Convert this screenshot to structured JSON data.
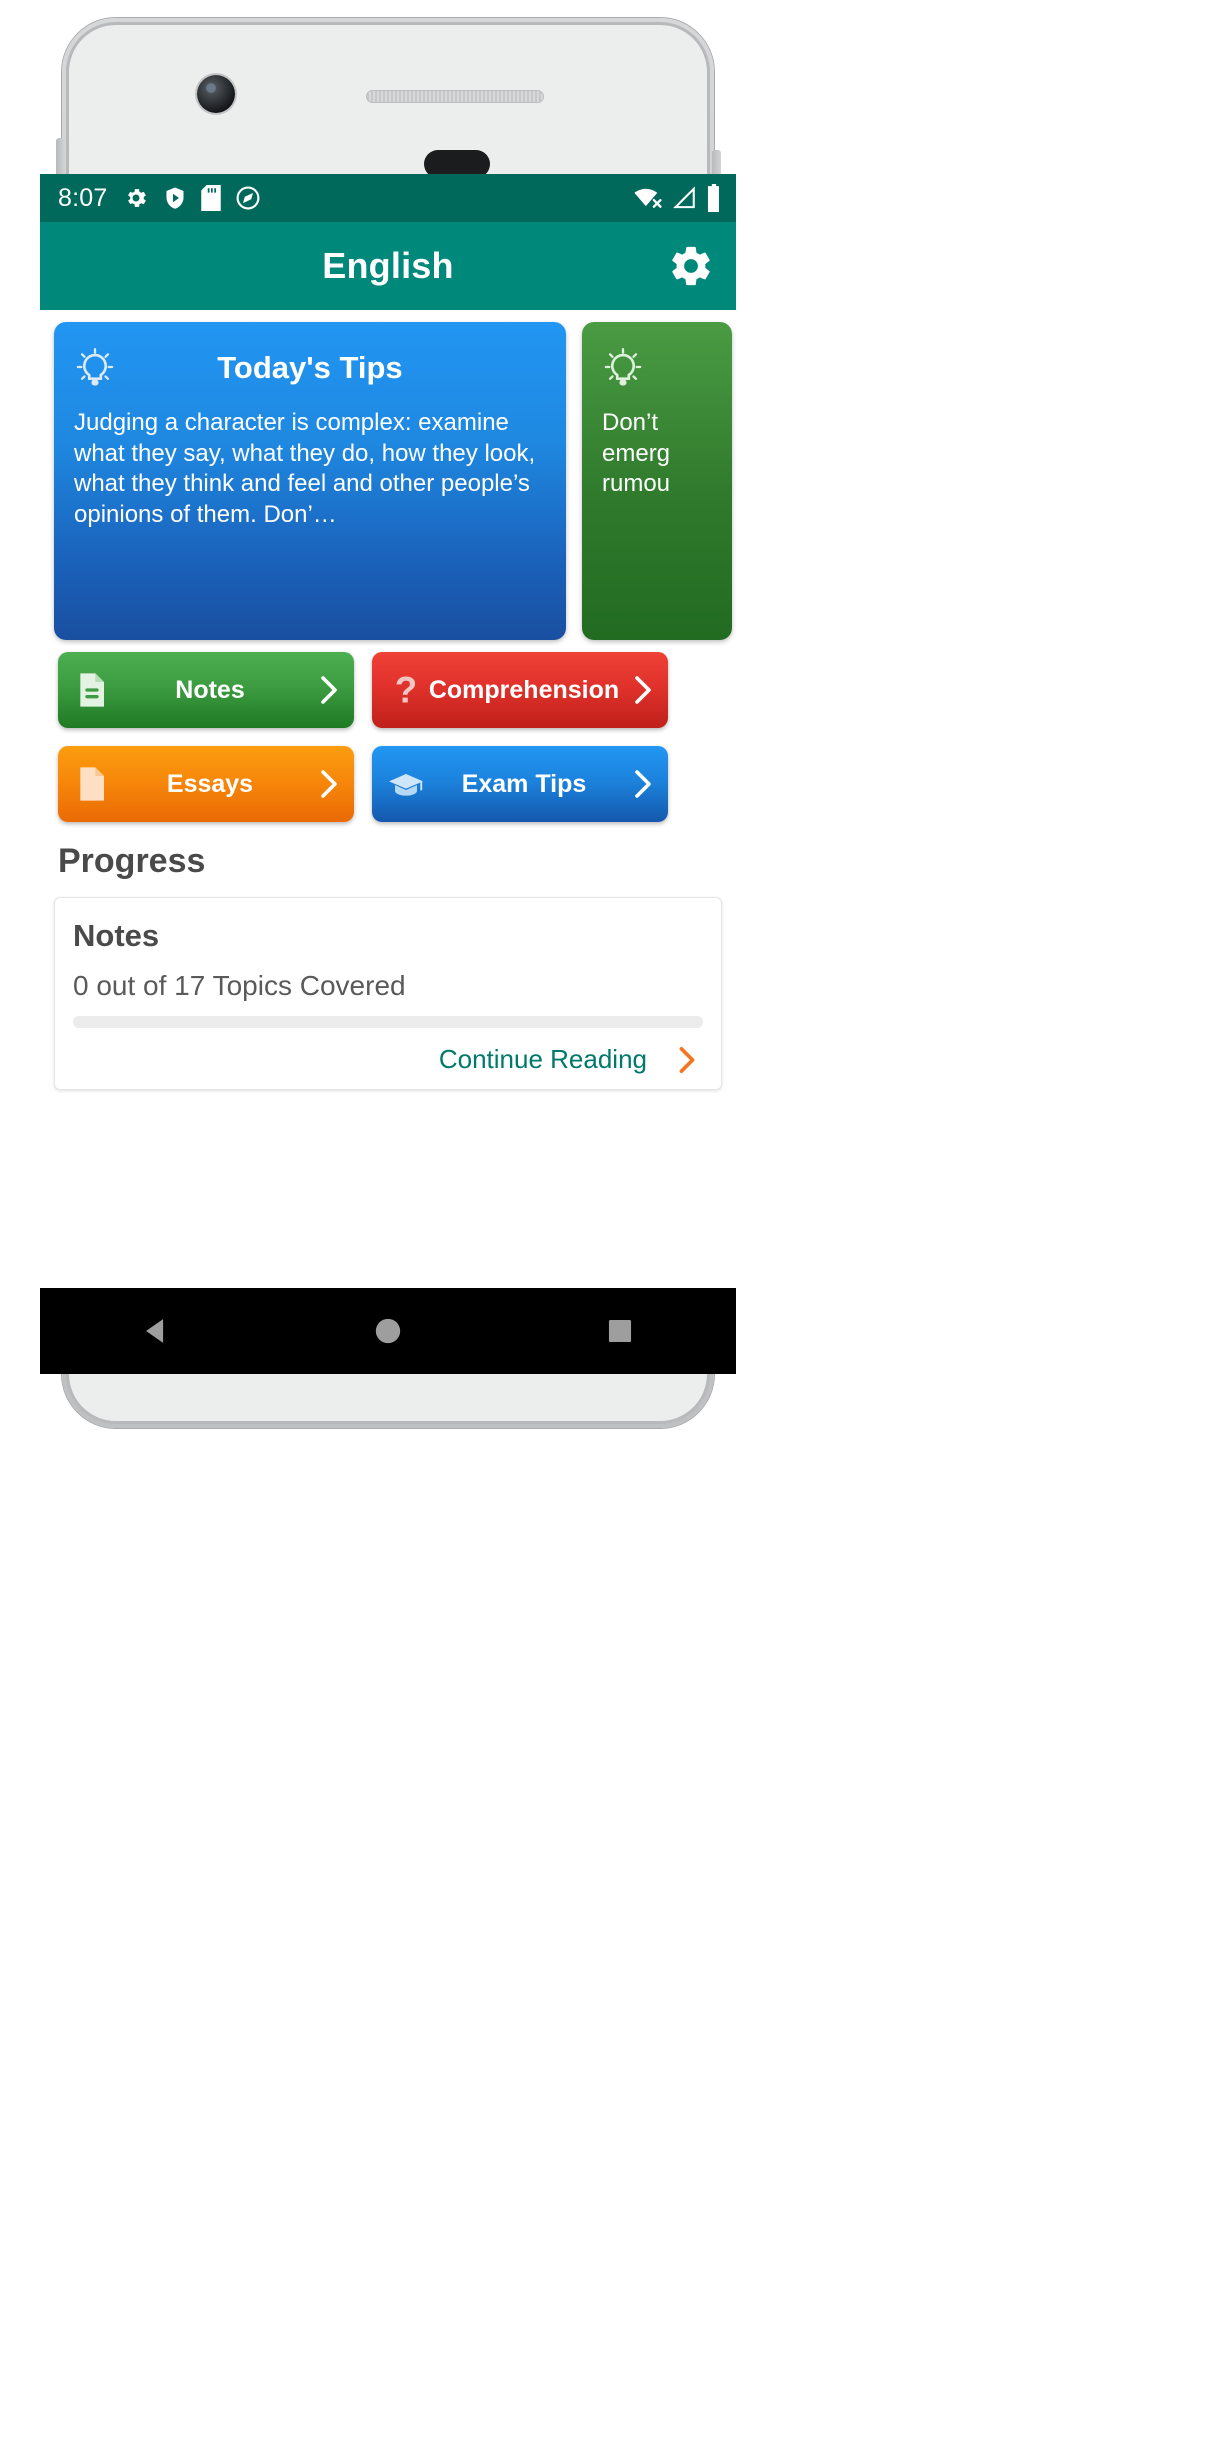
{
  "status_bar": {
    "time": "8:07",
    "left_icons": [
      "gear-icon",
      "play-protect-shield-icon",
      "sd-card-icon",
      "data-saver-icon"
    ],
    "right_icons": [
      "wifi-no-internet-icon",
      "cellular-signal-icon",
      "battery-full-icon"
    ],
    "background_color": "#00695c"
  },
  "app_bar": {
    "title": "English",
    "settings_icon": "gear-icon",
    "background_color": "#00897b"
  },
  "tips": {
    "cards": [
      {
        "icon": "lightbulb-icon",
        "title": "Today's Tips",
        "body": "Judging a character is complex: examine what they say, what they do, how they look, what they think and feel and other people’s opinions of them. Don’…",
        "color": "#2196f3"
      },
      {
        "icon": "lightbulb-icon",
        "title": "",
        "body": "Don’t emerg rumou",
        "color": "#2f7a2c"
      }
    ]
  },
  "actions": [
    {
      "label": "Notes",
      "icon": "document-lines-icon",
      "chevron": "chevron-right-icon",
      "color": "#3d9c41"
    },
    {
      "label": "Comprehension",
      "icon": "question-mark-icon",
      "chevron": "chevron-right-icon",
      "color": "#e0322b"
    },
    {
      "label": "Essays",
      "icon": "page-icon",
      "chevron": "chevron-right-icon",
      "color": "#f7880a"
    },
    {
      "label": "Exam Tips",
      "icon": "graduation-cap-icon",
      "chevron": "chevron-right-icon",
      "color": "#1c83dd"
    }
  ],
  "progress": {
    "heading": "Progress",
    "card": {
      "title": "Notes",
      "subtitle": "0 out of 17 Topics Covered",
      "percent": 0,
      "link_label": "Continue Reading",
      "link_color": "#00796b",
      "arrow_icon": "chevron-right-icon",
      "arrow_color": "#f4741f"
    }
  },
  "nav_bar": {
    "back": "back-triangle-icon",
    "home": "home-circle-icon",
    "recents": "recents-square-icon"
  }
}
